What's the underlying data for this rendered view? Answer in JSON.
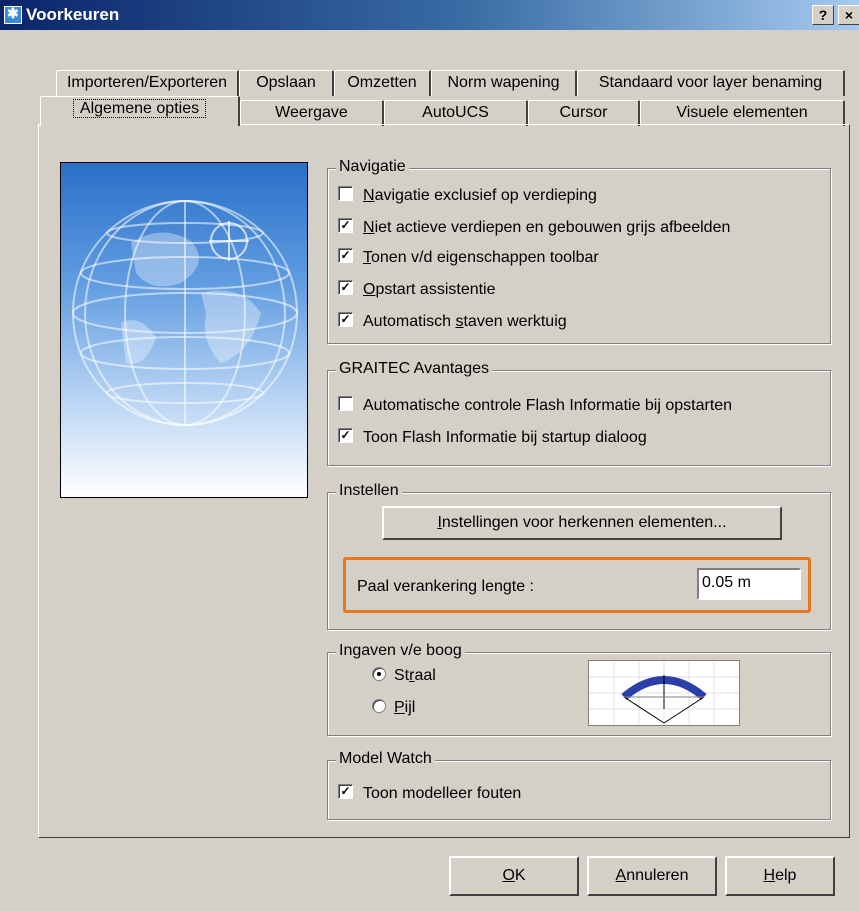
{
  "window": {
    "title": "Voorkeuren",
    "help_button": "?",
    "close_button": "×"
  },
  "tabs": {
    "row_back": [
      "Importeren/Exporteren",
      "Opslaan",
      "Omzetten",
      "Norm wapening",
      "Standaard voor layer benaming"
    ],
    "row_front": [
      "Algemene opties",
      "Weergave",
      "AutoUCS",
      "Cursor",
      "Visuele elementen"
    ],
    "active": "Algemene opties"
  },
  "navigatie": {
    "legend": "Navigatie",
    "items": [
      {
        "pre": "",
        "ul": "N",
        "post": "avigatie exclusief op verdieping",
        "checked": false,
        "mark": ""
      },
      {
        "pre": "",
        "ul": "N",
        "post": "iet actieve verdiepen en gebouwen grijs afbeelden",
        "checked": true,
        "mark": "✓"
      },
      {
        "pre": "",
        "ul": "T",
        "post": "onen v/d eigenschappen toolbar",
        "checked": true,
        "mark": "✓"
      },
      {
        "pre": "",
        "ul": "O",
        "post": "pstart assistentie",
        "checked": true,
        "mark": "✓"
      },
      {
        "pre": "Automatisch ",
        "ul": "s",
        "post": "taven werktuig",
        "checked": true,
        "mark": "✓"
      }
    ]
  },
  "graitec": {
    "legend": "GRAITEC Avantages",
    "items": [
      {
        "label": "Automatische controle Flash Informatie bij opstarten",
        "checked": false,
        "mark": ""
      },
      {
        "label": "Toon Flash Informatie bij startup dialoog",
        "checked": true,
        "mark": "✓"
      }
    ]
  },
  "instellen": {
    "legend": "Instellen",
    "button_ul": "I",
    "button_rest": "nstellingen voor herkennen elementen...",
    "paal_label": "Paal verankering lengte :",
    "paal_value": "0.05 m"
  },
  "boog": {
    "legend": "Ingaven v/e boog",
    "options": [
      {
        "pre": "St",
        "ul": "r",
        "post": "aal",
        "selected": true
      },
      {
        "pre": "",
        "ul": "P",
        "post": "ijl",
        "selected": false
      }
    ]
  },
  "modelwatch": {
    "legend": "Model Watch",
    "items": [
      {
        "label": "Toon modelleer fouten",
        "checked": true,
        "mark": "✓"
      }
    ]
  },
  "footer": {
    "ok_ul": "O",
    "ok_rest": "K",
    "cancel_ul": "A",
    "cancel_rest": "nnuleren",
    "help_ul": "H",
    "help_rest": "elp"
  },
  "colors": {
    "titlebar_start": "#0a246a",
    "titlebar_end": "#a6caf0",
    "face": "#d4d0c8",
    "highlight": "#e8771e",
    "arc": "#2a3fa8"
  }
}
